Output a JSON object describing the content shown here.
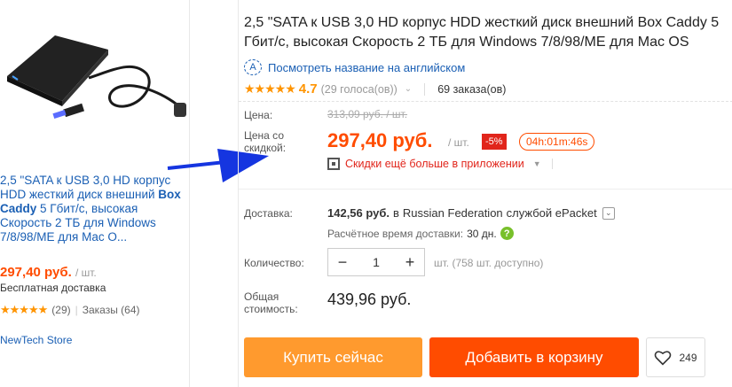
{
  "left_card": {
    "title_part1": "2,5 \"SATA к USB 3,0 HD корпус HDD жесткий диск внешний ",
    "title_bold": "Box Caddy",
    "title_part2": " 5 Гбит/с, высокая Скорость 2 ТБ для Windows 7/8/98/ME для Mac O...",
    "price": "297,40 руб.",
    "unit": "/ шт.",
    "shipping": "Бесплатная доставка",
    "stars": "★★★★★",
    "reviews": "(29)",
    "orders": "Заказы (64)",
    "store": "NewTech Store"
  },
  "product": {
    "title": "2,5 \"SATA к USB 3,0 HD корпус HDD жесткий диск внешний Box Caddy 5 Гбит/с, высокая Скорость 2 ТБ для Windows 7/8/98/ME для Mac OS",
    "translate_link": "Посмотреть название на английском",
    "stars": "★★★★★",
    "rating": "4.7",
    "votes": "(29 голоса(ов))",
    "orders": "69 заказа(ов)"
  },
  "pricing": {
    "price_label": "Цена:",
    "old_price": "313,09 руб. / шт.",
    "discount_label": "Цена со скидкой:",
    "price": "297,40 руб.",
    "unit": "/ шт.",
    "discount": "-5%",
    "timer": "04h:01m:46s",
    "app_discount": "Скидки ещё больше в приложении"
  },
  "shipping": {
    "label": "Доставка:",
    "cost": "142,56 руб.",
    "in": "в",
    "destination": "Russian Federation",
    "service": "службой ePacket",
    "eta_label": "Расчётное время доставки:",
    "eta_value": "30 дн."
  },
  "quantity": {
    "label": "Количество:",
    "value": "1",
    "minus": "−",
    "plus": "+",
    "stock": "шт. (758 шт. доступно)"
  },
  "total": {
    "label": "Общая стоимость:",
    "value": "439,96 руб."
  },
  "actions": {
    "buy": "Купить сейчас",
    "cart": "Добавить в корзину",
    "wish_count": "249"
  },
  "colors": {
    "price": "#ff4c00",
    "buy_button": "#ff9a2e",
    "cart_button": "#ff4c00",
    "arrow": "#1535e0"
  }
}
